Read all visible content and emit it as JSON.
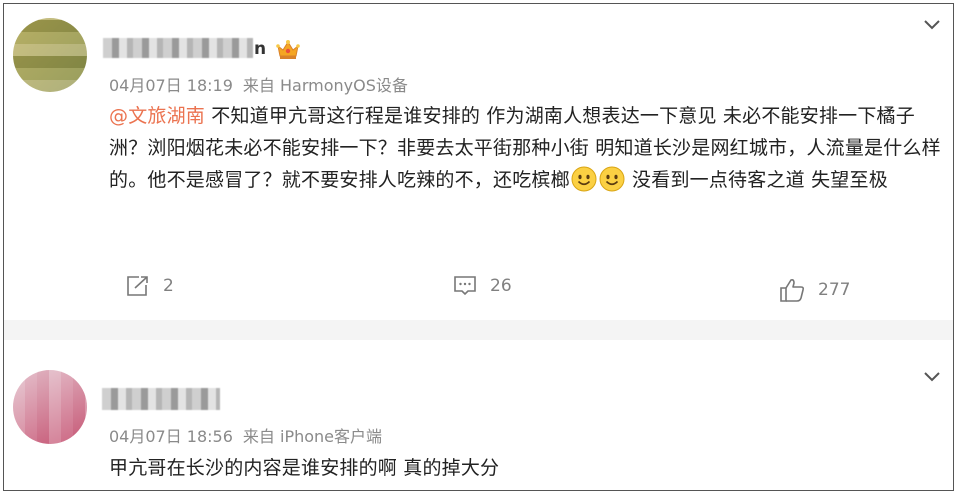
{
  "posts": [
    {
      "username_suffix": "n",
      "timestamp": "04月07日 18:19",
      "source": "来自 HarmonyOS设备",
      "mention": "@文旅湖南",
      "content_text": " 不知道甲亢哥这行程是谁安排的 作为湖南人想表达一下意见 未必不能安排一下橘子洲？浏阳烟花未必不能安排一下？非要去太平街那种小街 明知道长沙是网红城市，人流量是什么样的。他不是感冒了？就不要安排人吃辣的不，还吃槟榔",
      "content_tail": " 没看到一点待客之道 失望至极",
      "reposts": "2",
      "comments": "26",
      "likes": "277"
    },
    {
      "timestamp": "04月07日 18:56",
      "source": "来自 iPhone客户端",
      "content_text": "甲亢哥在长沙的内容是谁安排的啊 真的掉大分"
    }
  ],
  "colors": {
    "mention": "#eb7350",
    "meta": "#8a8a8a",
    "text": "#222222",
    "divider": "#f4f4f4"
  },
  "icons": [
    "crown-badge-icon",
    "chevron-down-icon",
    "smile-emoji-icon",
    "repost-icon",
    "comment-icon",
    "like-icon"
  ]
}
